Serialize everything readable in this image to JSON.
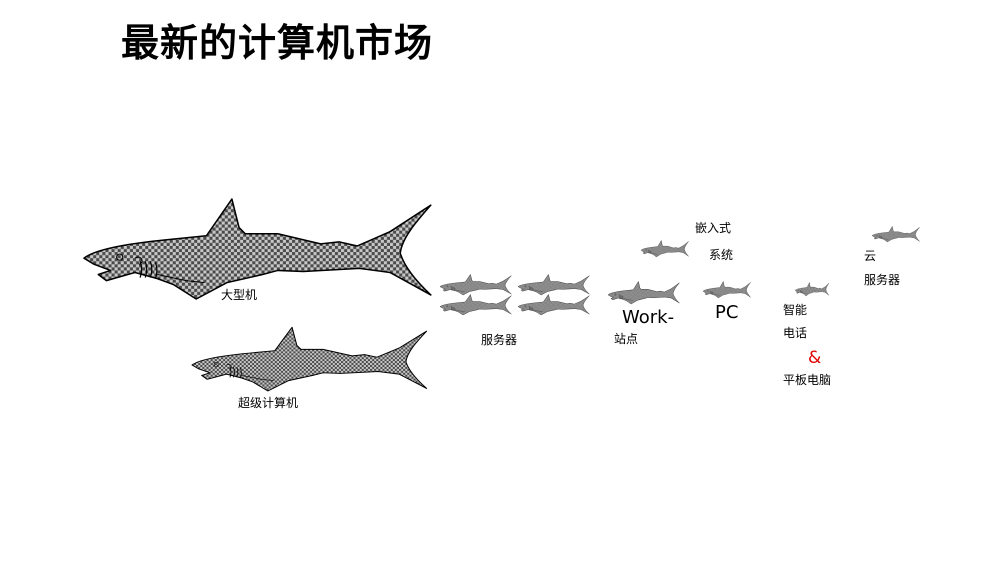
{
  "slide": {
    "title": "最新的计算机市场"
  },
  "labels": {
    "mainframe": "大型机",
    "supercomputer": "超级计算机",
    "servers": "服务器",
    "workstation_1": "Work-",
    "workstation_2": "站点",
    "pc": "PC",
    "embedded_1": "嵌入式",
    "embedded_2": "系统",
    "smart_1": "智能",
    "smart_2": "电话",
    "smart_amp": "&",
    "smart_3": "平板电脑",
    "cloud_1": "云",
    "cloud_2": "服务器"
  },
  "colors": {
    "shark_fill_dark": "#4a4a4a",
    "shark_fill_light": "#c8c8c8",
    "ampersand": "#e00000"
  }
}
